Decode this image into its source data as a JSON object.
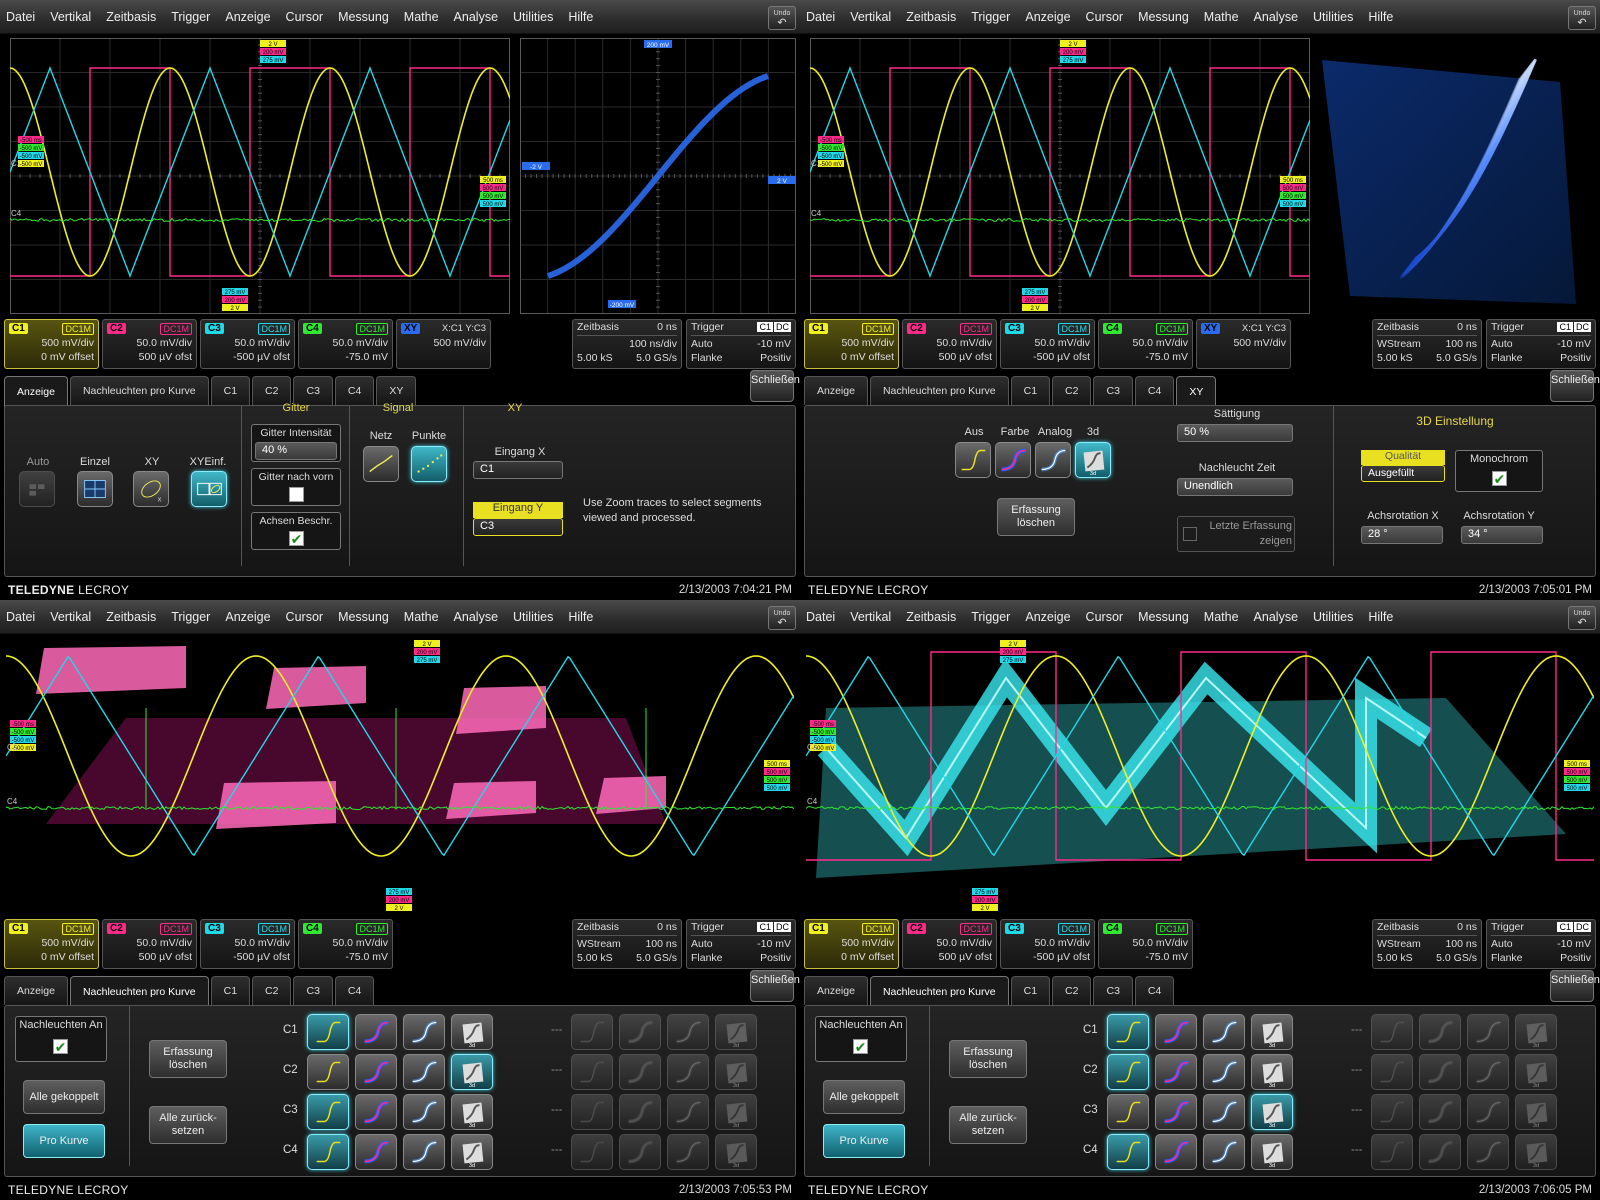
{
  "menu": [
    "Datei",
    "Vertikal",
    "Zeitbasis",
    "Trigger",
    "Anzeige",
    "Cursor",
    "Messung",
    "Mathe",
    "Analyse",
    "Utilities",
    "Hilfe"
  ],
  "undo_label": "Undo",
  "colors": {
    "c1": "#f0f020",
    "c2": "#ff2a8a",
    "c3": "#20d8e8",
    "c4": "#30e830",
    "xy": "#2a6cf0"
  },
  "channels": [
    {
      "id": "C1",
      "coupling": "DC1M",
      "vdiv": "500 mV/div",
      "offset": "0 mV offset",
      "color": "#f0f020"
    },
    {
      "id": "C2",
      "coupling": "DC1M",
      "vdiv": "50.0 mV/div",
      "offset": "500 µV ofst",
      "color": "#ff2a8a"
    },
    {
      "id": "C3",
      "coupling": "DC1M",
      "vdiv": "50.0 mV/div",
      "offset": "-500 µV ofst",
      "color": "#20d8e8"
    },
    {
      "id": "C4",
      "coupling": "DC1M",
      "vdiv": "50.0 mV/div",
      "offset": "-75.0 mV",
      "color": "#30e830"
    }
  ],
  "xy_card": {
    "id": "XY",
    "source": "X:C1 Y:C3",
    "vdiv": "500 mV/div"
  },
  "timebase_q0": {
    "title": "Zeitbasis",
    "delay": "0 ns",
    "mode": "",
    "tdiv": "100 ns/div",
    "samples": "5.00 kS",
    "rate": "5.0 GS/s"
  },
  "timebase": {
    "title": "Zeitbasis",
    "delay": "0 ns",
    "mode": "WStream",
    "tdiv": "100 ns",
    "samples": "5.00 kS",
    "rate": "5.0 GS/s"
  },
  "trigger": {
    "title": "Trigger",
    "src": "C1",
    "cpl": "DC",
    "mode": "Auto",
    "level": "-10 mV",
    "type": "Flanke",
    "slope": "Positiv"
  },
  "close_label": "Schließen",
  "footer": {
    "brand_a": "TELEDYNE",
    "brand_b": "LECROY",
    "dates": [
      "2/13/2003 7:04:21 PM",
      "2/13/2003 7:05:01 PM",
      "2/13/2003 7:05:53 PM",
      "2/13/2003 7:06:05 PM"
    ]
  },
  "tabs": {
    "q0": [
      "Anzeige",
      "Nachleuchten pro Kurve",
      "C1",
      "C2",
      "C3",
      "C4",
      "XY"
    ],
    "q1": [
      "Anzeige",
      "Nachleuchten pro Kurve",
      "C1",
      "C2",
      "C3",
      "C4",
      "XY"
    ],
    "q2": [
      "Anzeige",
      "Nachleuchten pro Kurve",
      "C1",
      "C2",
      "C3",
      "C4"
    ],
    "q3": [
      "Anzeige",
      "Nachleuchten pro Kurve",
      "C1",
      "C2",
      "C3",
      "C4"
    ]
  },
  "display_panel": {
    "modes": [
      "Auto",
      "Einzel",
      "XY",
      "XYEinf."
    ],
    "gitter": "Gitter",
    "gitter_int": "Gitter Intensität",
    "gitter_val": "40 %",
    "gitter_vorn": "Gitter nach vorn",
    "achsen": "Achsen Beschr.",
    "signal": "Signal",
    "netz": "Netz",
    "punkte": "Punkte",
    "xy": "XY",
    "eingang_x": "Eingang X",
    "eingang_x_val": "C1",
    "eingang_y": "Eingang Y",
    "eingang_y_val": "C3",
    "hint": "Use Zoom traces to select segments viewed and processed."
  },
  "xy_panel": {
    "modes": [
      "Aus",
      "Farbe",
      "Analog",
      "3d"
    ],
    "erfassung": "Erfassung löschen",
    "saettigung": "Sättigung",
    "saett_val": "50 %",
    "nachleucht": "Nachleucht Zeit",
    "nachleucht_val": "Unendlich",
    "letzte": "Letzte Erfassung zeigen",
    "title3d": "3D Einstellung",
    "qualitaet": "Qualität",
    "ausgefuellt": "Ausgefüllt",
    "monochrom": "Monochrom",
    "rotx": "Achsrotation X",
    "rotx_val": "28 °",
    "roty": "Achsrotation Y",
    "roty_val": "34 °"
  },
  "persist_panel": {
    "an": "Nachleuchten An",
    "gekoppelt": "Alle gekoppelt",
    "pro": "Pro Kurve",
    "erfassung": "Erfassung löschen",
    "zurueck": "Alle zurück-setzen",
    "rows": [
      "C1",
      "C2",
      "C3",
      "C4"
    ],
    "dash": "---"
  },
  "trace_labels": {
    "yellow": "2 V",
    "magenta": "200 mV",
    "cyan": "275 mV",
    "left": [
      "-500 ms",
      "-500 mV",
      "-500 mV",
      "-500 mV"
    ],
    "right": [
      "500 ms",
      "500 mV",
      "500 mV",
      "500 mV"
    ],
    "xy_top": "200 mV",
    "xy_bot": "-200 mV",
    "xy_left": "-2 V",
    "xy_right": "2 V"
  }
}
